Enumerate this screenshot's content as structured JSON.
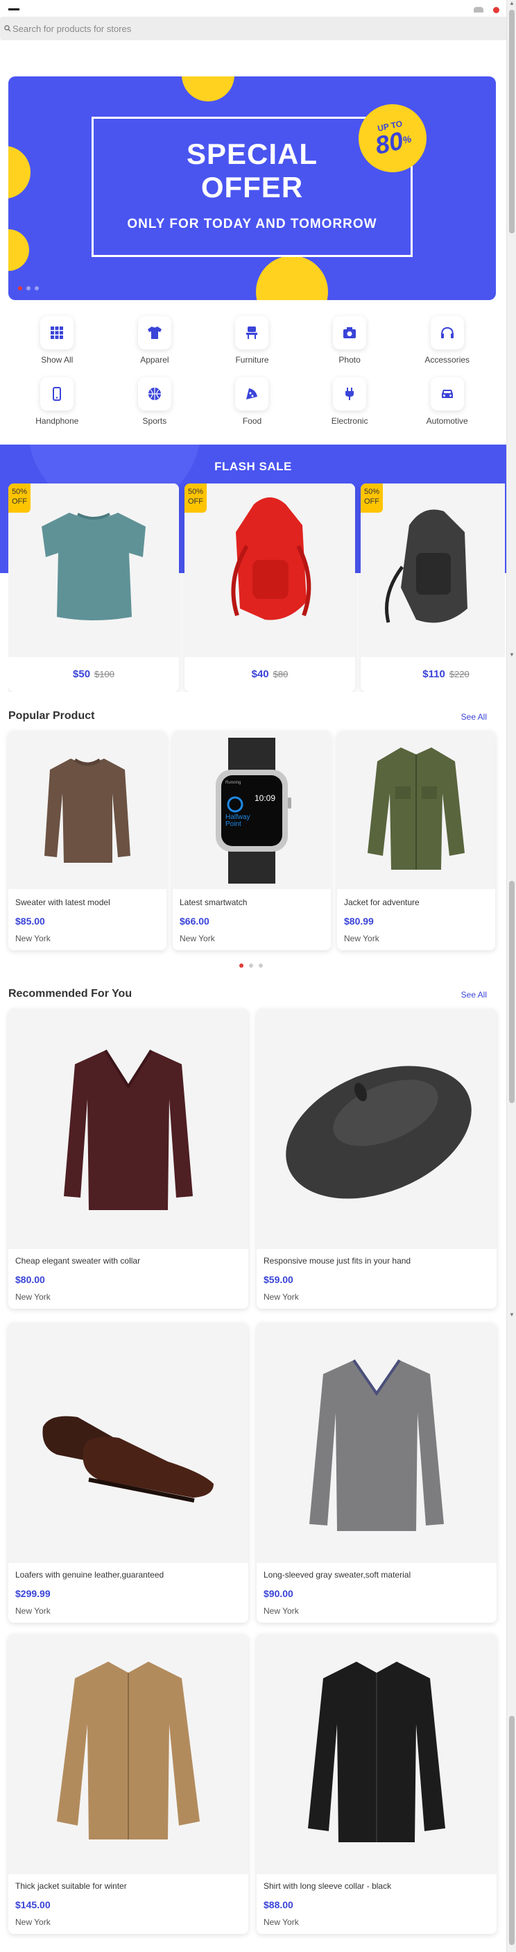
{
  "search": {
    "placeholder": "Search for products for stores"
  },
  "banner": {
    "line1": "SPECIAL",
    "line2": "OFFER",
    "subtitle": "ONLY FOR TODAY AND TOMORROW",
    "badge_top": "UP TO",
    "badge_num": "80",
    "badge_pct": "%",
    "active_slide": 1,
    "slides": 3
  },
  "categories": [
    {
      "label": "Show All",
      "icon": "grid-icon"
    },
    {
      "label": "Apparel",
      "icon": "shirt-icon"
    },
    {
      "label": "Furniture",
      "icon": "chair-icon"
    },
    {
      "label": "Photo",
      "icon": "camera-icon"
    },
    {
      "label": "Accessories",
      "icon": "headphones-icon"
    },
    {
      "label": "Handphone",
      "icon": "phone-icon"
    },
    {
      "label": "Sports",
      "icon": "ball-icon"
    },
    {
      "label": "Food",
      "icon": "pizza-icon"
    },
    {
      "label": "Electronic",
      "icon": "plug-icon"
    },
    {
      "label": "Automotive",
      "icon": "car-icon"
    }
  ],
  "flash_sale": {
    "title": "FLASH SALE",
    "items": [
      {
        "badge1": "50%",
        "badge2": "OFF",
        "price": "$50",
        "old_price": "$100",
        "image": "teal-tshirt"
      },
      {
        "badge1": "50%",
        "badge2": "OFF",
        "price": "$40",
        "old_price": "$80",
        "image": "red-backpack"
      },
      {
        "badge1": "50%",
        "badge2": "OFF",
        "price": "$110",
        "old_price": "$220",
        "image": "black-backpack"
      }
    ]
  },
  "popular": {
    "title": "Popular Product",
    "see_all": "See All",
    "items": [
      {
        "name": "Sweater with latest model",
        "price": "$85.00",
        "location": "New York",
        "image": "brown-sweater"
      },
      {
        "name": "Latest smartwatch",
        "price": "$66.00",
        "location": "New York",
        "image": "smartwatch",
        "watch_time": "10:09",
        "watch_label": "Running",
        "watch_text": "Halfway Point"
      },
      {
        "name": "Jacket for adventure",
        "price": "$80.99",
        "location": "New York",
        "image": "green-jacket"
      }
    ],
    "active_page": 1
  },
  "recommended": {
    "title": "Recommended For You",
    "see_all": "See All",
    "items": [
      {
        "name": "Cheap elegant sweater with collar",
        "price": "$80.00",
        "location": "New York",
        "image": "maroon-sweater"
      },
      {
        "name": "Responsive mouse just fits in your hand",
        "price": "$59.00",
        "location": "New York",
        "image": "black-mouse"
      },
      {
        "name": "Loafers with genuine leather,guaranteed",
        "price": "$299.99",
        "location": "New York",
        "image": "leather-shoes"
      },
      {
        "name": "Long-sleeved gray sweater,soft material",
        "price": "$90.00",
        "location": "New York",
        "image": "gray-sweater"
      },
      {
        "name": "Thick jacket suitable for winter",
        "price": "$145.00",
        "location": "New York",
        "image": "tan-jacket"
      },
      {
        "name": "Shirt with long sleeve collar - black",
        "price": "$88.00",
        "location": "New York",
        "image": "black-jacket"
      }
    ]
  },
  "colors": {
    "accent": "#4a55f0",
    "price": "#3a44d8",
    "yellow": "#ffd21f",
    "active_dot": "#e53935"
  }
}
